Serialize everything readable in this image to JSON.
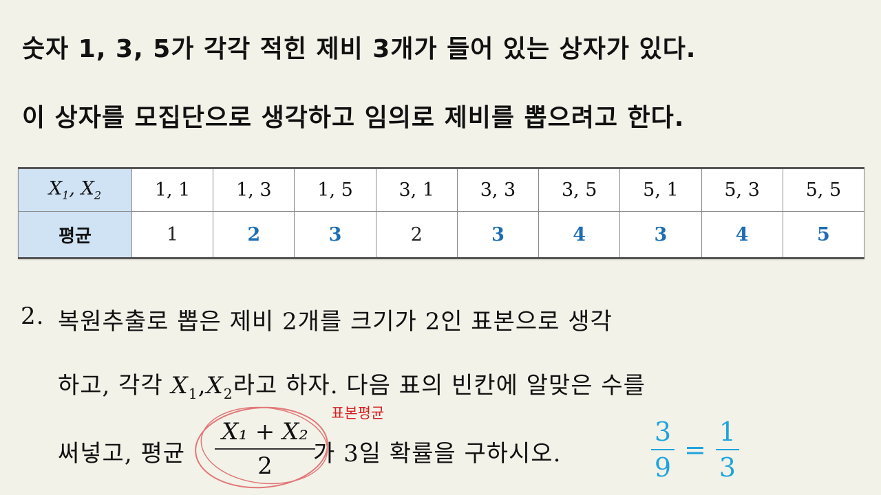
{
  "intro": {
    "line1": "숫자 1, 3, 5가 각각 적힌 제비 3개가 들어 있는 상자가 있다.",
    "line2": "이 상자를 모집단으로 생각하고 임의로 제비를 뽑으려고 한다."
  },
  "table": {
    "header_var": "X",
    "header_var_sub1": "1",
    "header_sep": ", ",
    "header_var_sub2": "2",
    "header_mean": "평균",
    "pairs": [
      "1, 1",
      "1, 3",
      "1, 5",
      "3, 1",
      "3, 3",
      "3, 5",
      "5, 1",
      "5, 3",
      "5, 5"
    ],
    "means": [
      "1",
      "2",
      "3",
      "2",
      "3",
      "4",
      "3",
      "4",
      "5"
    ],
    "mean_color": "#1c6eb4"
  },
  "question": {
    "number": "2.",
    "line1": "복원추출로 뽑은 제비 2개를 크기가 2인 표본으로 생각",
    "line2_a": "하고, 각각 ",
    "line2_b": "라고 하자. 다음 표의 빈칸에 알맞은 수를",
    "line3_a": "써넣고, 평균",
    "line3_b": "가 3일 확률을 구하시오.",
    "frac_num": "X₁ + X₂",
    "frac_den": "2"
  },
  "annotation": {
    "label": "표본평균",
    "color": "#d42020"
  },
  "answer": {
    "num1": "3",
    "den1": "9",
    "eq": "=",
    "num2": "1",
    "den2": "3",
    "color": "#1ea4dc"
  }
}
